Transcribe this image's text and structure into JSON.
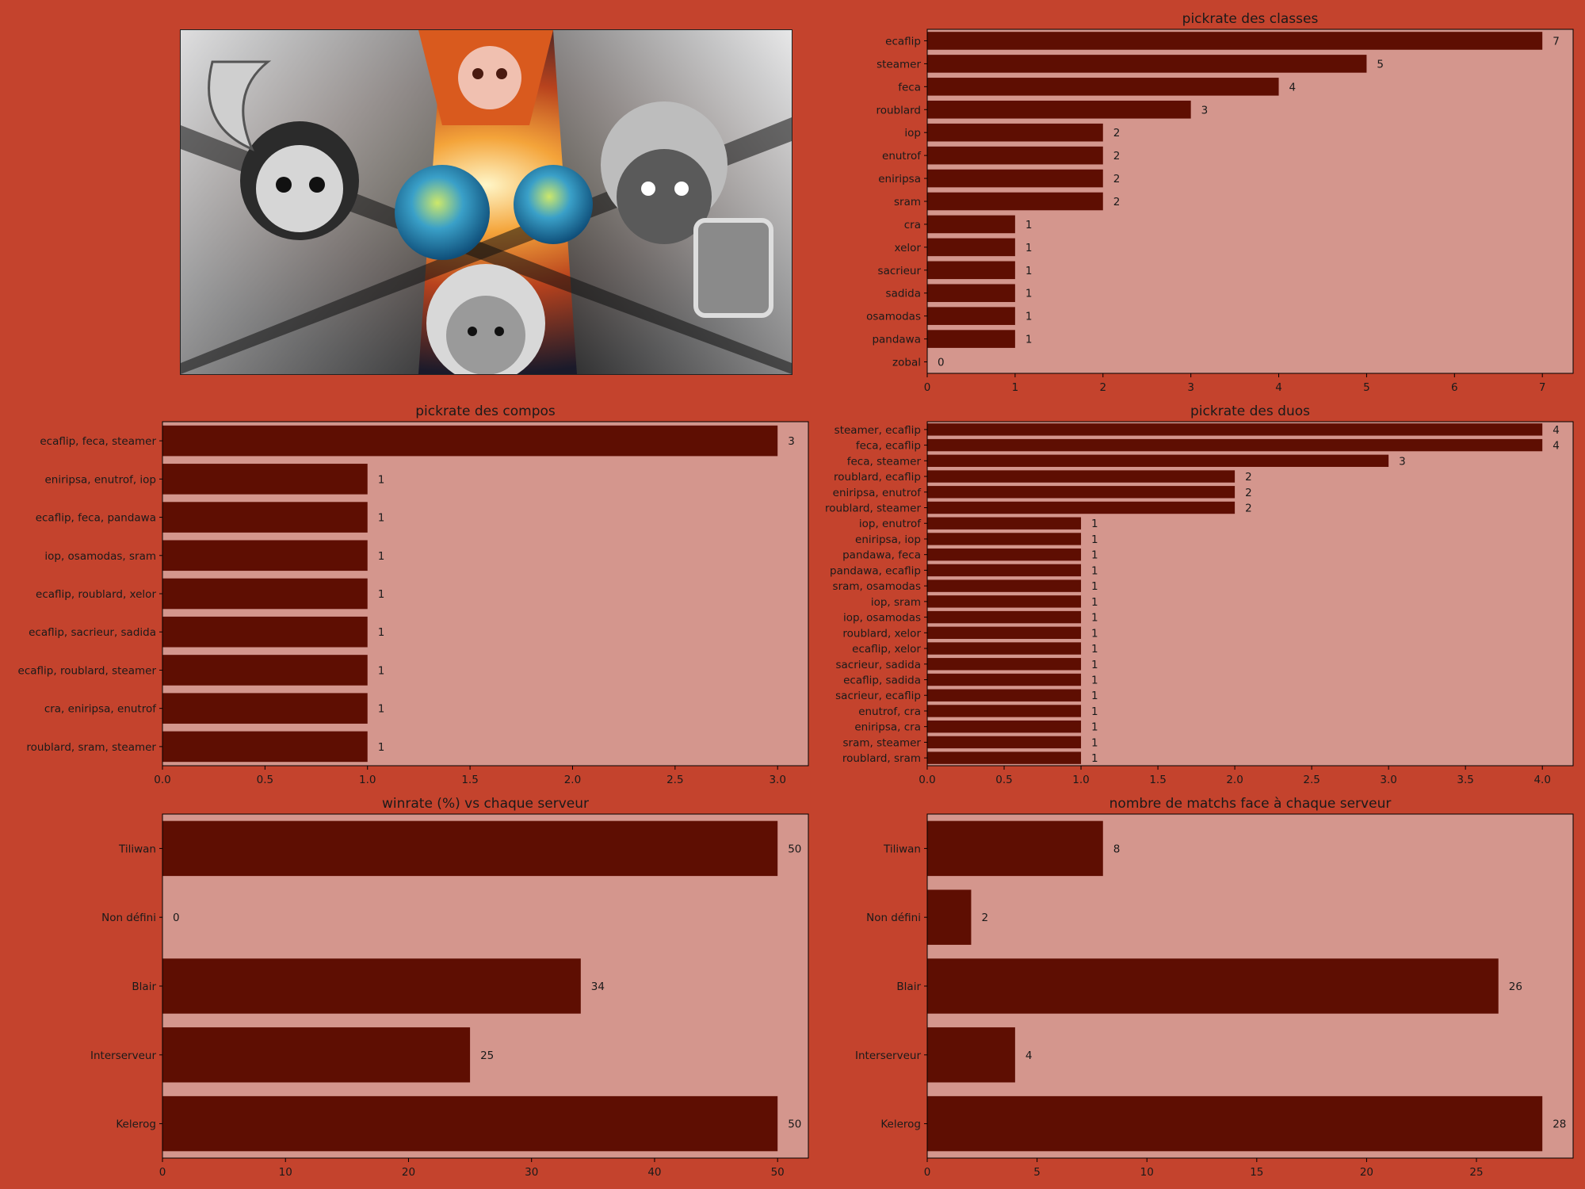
{
  "colors": {
    "figure_bg": "#c4432d",
    "axes_bg": "#d4968d",
    "bar": "#5e0e02",
    "text": "#1a1a1a"
  },
  "artwork": {
    "icon": "game-artwork-illustration"
  },
  "chart_data": [
    {
      "id": "classes",
      "type": "bar",
      "orientation": "horizontal",
      "title": "pickrate des classes",
      "xlabel": "",
      "ylabel": "",
      "categories": [
        "ecaflip",
        "steamer",
        "feca",
        "roublard",
        "iop",
        "enutrof",
        "eniripsa",
        "sram",
        "cra",
        "xelor",
        "sacrieur",
        "sadida",
        "osamodas",
        "pandawa",
        "zobal"
      ],
      "values": [
        7,
        5,
        4,
        3,
        2,
        2,
        2,
        2,
        1,
        1,
        1,
        1,
        1,
        1,
        0
      ],
      "xlim": [
        0,
        7.35
      ],
      "xticks": [
        0,
        1,
        2,
        3,
        4,
        5,
        6,
        7
      ],
      "xtick_labels": [
        "0",
        "1",
        "2",
        "3",
        "4",
        "5",
        "6",
        "7"
      ],
      "value_labels": [
        "7",
        "5",
        "4",
        "3",
        "2",
        "2",
        "2",
        "2",
        "1",
        "1",
        "1",
        "1",
        "1",
        "1",
        "0"
      ],
      "grid": false
    },
    {
      "id": "compos",
      "type": "bar",
      "orientation": "horizontal",
      "title": "pickrate des compos",
      "xlabel": "",
      "ylabel": "",
      "categories": [
        "ecaflip, feca, steamer",
        "eniripsa, enutrof, iop",
        "ecaflip, feca, pandawa",
        "iop, osamodas, sram",
        "ecaflip, roublard, xelor",
        "ecaflip, sacrieur, sadida",
        "ecaflip, roublard, steamer",
        "cra, eniripsa, enutrof",
        "roublard, sram, steamer"
      ],
      "values": [
        3,
        1,
        1,
        1,
        1,
        1,
        1,
        1,
        1
      ],
      "xlim": [
        0,
        3.15
      ],
      "xticks": [
        0,
        0.5,
        1,
        1.5,
        2,
        2.5,
        3
      ],
      "xtick_labels": [
        "0.0",
        "0.5",
        "1.0",
        "1.5",
        "2.0",
        "2.5",
        "3.0"
      ],
      "value_labels": [
        "3",
        "1",
        "1",
        "1",
        "1",
        "1",
        "1",
        "1",
        "1"
      ],
      "grid": false
    },
    {
      "id": "duos",
      "type": "bar",
      "orientation": "horizontal",
      "title": "pickrate des duos",
      "xlabel": "",
      "ylabel": "",
      "categories": [
        "steamer, ecaflip",
        "feca, ecaflip",
        "feca, steamer",
        "roublard, ecaflip",
        "eniripsa, enutrof",
        "roublard, steamer",
        "iop, enutrof",
        "eniripsa, iop",
        "pandawa, feca",
        "pandawa, ecaflip",
        "sram, osamodas",
        "iop, sram",
        "iop, osamodas",
        "roublard, xelor",
        "ecaflip, xelor",
        "sacrieur, sadida",
        "ecaflip, sadida",
        "sacrieur, ecaflip",
        "enutrof, cra",
        "eniripsa, cra",
        "sram, steamer",
        "roublard, sram"
      ],
      "values": [
        4,
        4,
        3,
        2,
        2,
        2,
        1,
        1,
        1,
        1,
        1,
        1,
        1,
        1,
        1,
        1,
        1,
        1,
        1,
        1,
        1,
        1
      ],
      "xlim": [
        0,
        4.2
      ],
      "xticks": [
        0,
        0.5,
        1,
        1.5,
        2,
        2.5,
        3,
        3.5,
        4
      ],
      "xtick_labels": [
        "0.0",
        "0.5",
        "1.0",
        "1.5",
        "2.0",
        "2.5",
        "3.0",
        "3.5",
        "4.0"
      ],
      "value_labels": [
        "4",
        "4",
        "3",
        "2",
        "2",
        "2",
        "1",
        "1",
        "1",
        "1",
        "1",
        "1",
        "1",
        "1",
        "1",
        "1",
        "1",
        "1",
        "1",
        "1",
        "1",
        "1"
      ],
      "grid": false
    },
    {
      "id": "winrate",
      "type": "bar",
      "orientation": "horizontal",
      "title": "winrate (%) vs chaque serveur",
      "xlabel": "",
      "ylabel": "",
      "categories": [
        "Tiliwan",
        "Non défini",
        "Blair",
        "Interserveur",
        "Kelerog"
      ],
      "values": [
        50,
        0,
        34,
        25,
        50
      ],
      "xlim": [
        0,
        52.5
      ],
      "xticks": [
        0,
        10,
        20,
        30,
        40,
        50
      ],
      "xtick_labels": [
        "0",
        "10",
        "20",
        "30",
        "40",
        "50"
      ],
      "value_labels": [
        "50",
        "0",
        "34",
        "25",
        "50"
      ],
      "grid": false
    },
    {
      "id": "matchs",
      "type": "bar",
      "orientation": "horizontal",
      "title": "nombre de matchs face à chaque serveur",
      "xlabel": "",
      "ylabel": "",
      "categories": [
        "Tiliwan",
        "Non défini",
        "Blair",
        "Interserveur",
        "Kelerog"
      ],
      "values": [
        8,
        2,
        26,
        4,
        28
      ],
      "xlim": [
        0,
        29.4
      ],
      "xticks": [
        0,
        5,
        10,
        15,
        20,
        25
      ],
      "xtick_labels": [
        "0",
        "5",
        "10",
        "15",
        "20",
        "25"
      ],
      "value_labels": [
        "8",
        "2",
        "26",
        "4",
        "28"
      ],
      "grid": false
    }
  ]
}
